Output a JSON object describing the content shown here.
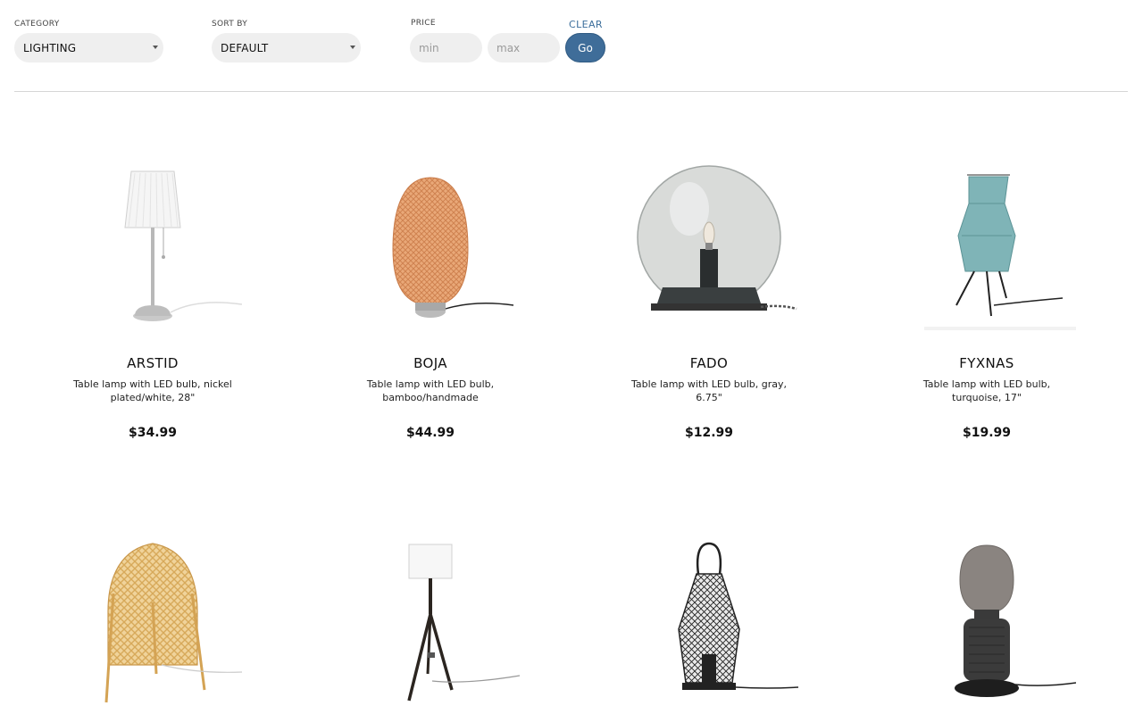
{
  "filters": {
    "category": {
      "label": "CATEGORY",
      "value": "LIGHTING"
    },
    "sort": {
      "label": "SORT BY",
      "value": "DEFAULT"
    },
    "price": {
      "label": "PRICE",
      "min_placeholder": "min",
      "max_placeholder": "max",
      "clear_label": "CLEAR",
      "go_label": "Go"
    }
  },
  "colors": {
    "accent": "#3f6d99",
    "link": "#3d6f9c",
    "field_bg": "#efefef"
  },
  "products": [
    {
      "name": "ARSTID",
      "desc": "Table lamp with LED bulb, nickel plated/white, 28\"",
      "price": "$34.99",
      "icon": "table-lamp-white-shade-image"
    },
    {
      "name": "BOJA",
      "desc": "Table lamp with LED bulb, bamboo/handmade",
      "price": "$44.99",
      "icon": "bamboo-lamp-image"
    },
    {
      "name": "FADO",
      "desc": "Table lamp with LED bulb, gray, 6.75\"",
      "price": "$12.99",
      "icon": "glass-globe-lamp-image"
    },
    {
      "name": "FYXNAS",
      "desc": "Table lamp with LED bulb, turquoise, 17\"",
      "price": "$19.99",
      "icon": "turquoise-lamp-image"
    },
    {
      "icon": "bamboo-cage-lamp-image"
    },
    {
      "icon": "tripod-floor-lamp-image"
    },
    {
      "icon": "wire-lantern-lamp-image"
    },
    {
      "icon": "speaker-lamp-image"
    }
  ]
}
